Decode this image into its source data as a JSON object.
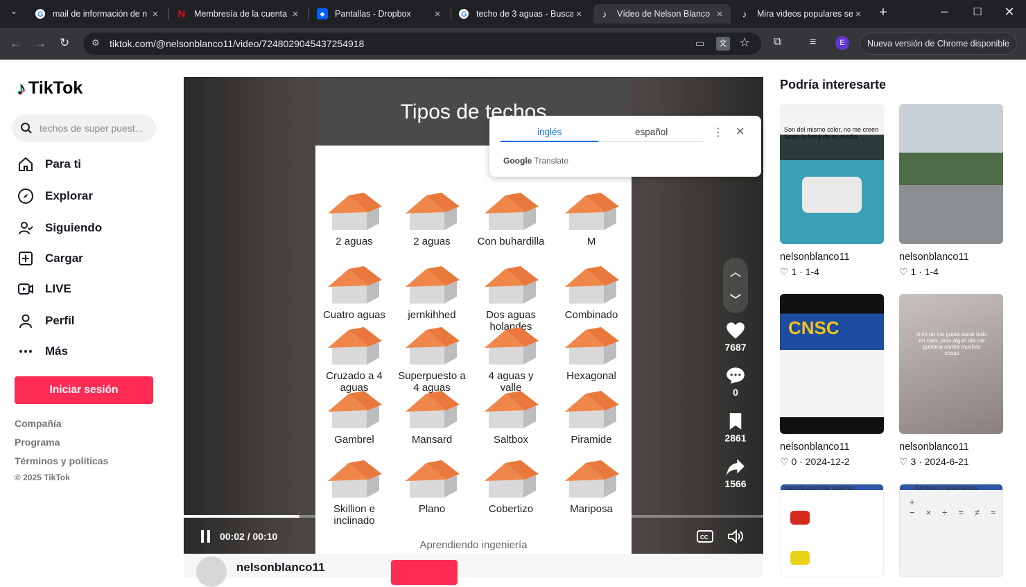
{
  "browser": {
    "tabs": [
      {
        "title": "mail de información de n",
        "icon": "google-icon",
        "active": false
      },
      {
        "title": "Membresía de la cuenta",
        "icon": "netflix-icon",
        "active": false
      },
      {
        "title": "Pantallas - Dropbox",
        "icon": "dropbox-icon",
        "active": false
      },
      {
        "title": "techo de 3 aguas - Busca",
        "icon": "google-icon",
        "active": false
      },
      {
        "title": "Vídeo de Nelson Blanco",
        "icon": "tiktok-icon",
        "active": true
      },
      {
        "title": "Mira videos populares se",
        "icon": "tiktok-icon",
        "active": false
      }
    ],
    "url": "tiktok.com/@nelsonblanco11/video/7248029045437254918",
    "profile_initial": "E",
    "update_label": "Nueva versión de Chrome disponible"
  },
  "translate": {
    "lang_from": "inglés",
    "lang_to": "español",
    "brand_google": "Google",
    "brand_translate": "Translate"
  },
  "sidebar": {
    "logo": "TikTok",
    "search_placeholder": "techos de super puest...",
    "nav": [
      {
        "label": "Para ti",
        "icon": "home-icon"
      },
      {
        "label": "Explorar",
        "icon": "compass-icon"
      },
      {
        "label": "Siguiendo",
        "icon": "following-icon"
      },
      {
        "label": "Cargar",
        "icon": "upload-icon"
      },
      {
        "label": "LIVE",
        "icon": "live-icon"
      },
      {
        "label": "Perfil",
        "icon": "profile-icon"
      },
      {
        "label": "Más",
        "icon": "more-icon"
      }
    ],
    "login": "Iniciar sesión",
    "footer": [
      "Compañía",
      "Programa",
      "Términos y políticas"
    ],
    "copyright": "© 2025 TikTok"
  },
  "video": {
    "title": "Tipos de techos",
    "watermark": "Aprendiendo ingeniería",
    "roofs": [
      [
        "2 aguas",
        "2 aguas",
        "Con buhardilla",
        "M"
      ],
      [
        "Cuatro aguas",
        "jernkihhed",
        "Dos aguas holandes",
        "Combinado"
      ],
      [
        "Cruzado a 4 aguas",
        "Superpuesto a 4 aguas",
        "4 aguas y valle",
        "Hexagonal"
      ],
      [
        "Gambrel",
        "Mansard",
        "Saltbox",
        "Piramide"
      ],
      [
        "Skillion e inclinado",
        "Plano",
        "Cobertizo",
        "Mariposa"
      ]
    ],
    "time": "00:02 / 00:10",
    "progress": 0.2,
    "likes": "7687",
    "comments": "0",
    "saves": "2861",
    "shares": "1566",
    "author": "nelsonblanco11"
  },
  "suggestions": {
    "title": "Podría interesarte",
    "cards": [
      {
        "user": "nelsonblanco11",
        "likes": "1",
        "date": "1-4",
        "caption": "Son del mismo color, no me creen tapen la linea de en medio"
      },
      {
        "user": "nelsonblanco11",
        "likes": "1",
        "date": "1-4",
        "caption": ""
      },
      {
        "user": "nelsonblanco11",
        "likes": "0",
        "date": "2024-12-2",
        "caption": "CNSC"
      },
      {
        "user": "nelsonblanco11",
        "likes": "3",
        "date": "2024-6-21",
        "caption": "A mi no me gusta sacar todo en cara, pero algun dia me gustaria contar muchas cosas"
      },
      {
        "user": "",
        "likes": "",
        "date": "",
        "caption": "Identificación de tuberías"
      },
      {
        "user": "",
        "likes": "",
        "date": "",
        "caption": "Símbolos matemáticos"
      }
    ]
  },
  "colors": {
    "accent": "#fe2c55",
    "roof": "#f0874a",
    "chrome_dark": "#202124"
  }
}
